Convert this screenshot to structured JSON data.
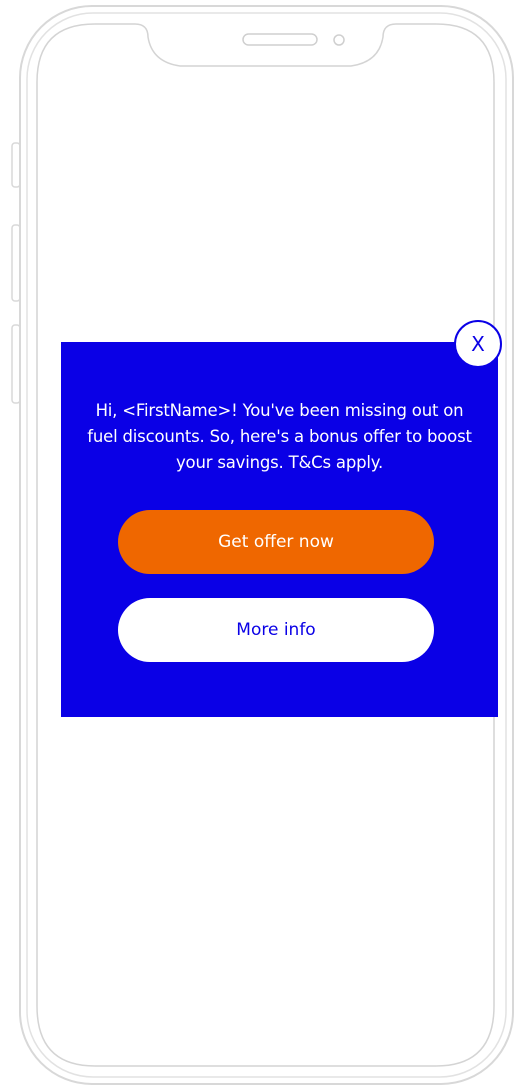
{
  "popup": {
    "message": "Hi, <FirstName>! You've been missing out on fuel discounts. So, here's a bonus offer to boost your savings. T&Cs apply.",
    "primary_button_label": "Get offer now",
    "secondary_button_label": "More info",
    "close_label": "X"
  },
  "colors": {
    "popup_background": "#0a00e6",
    "primary_button": "#ef6700",
    "secondary_button": "#ffffff",
    "phone_outline": "#d4d4d4"
  },
  "icons": {
    "close": "close-icon"
  }
}
